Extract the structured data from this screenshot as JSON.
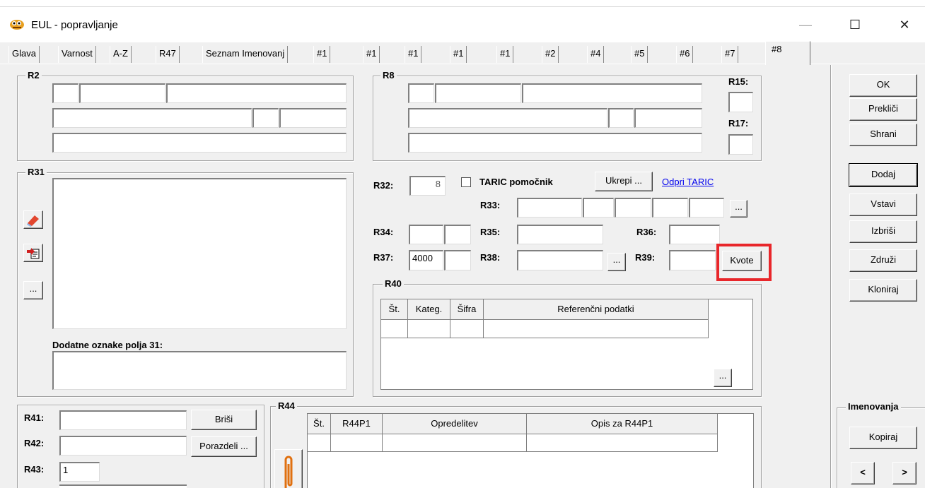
{
  "window": {
    "title": "EUL - popravljanje",
    "minimize_glyph": "—",
    "maximize_glyph": "☐",
    "close_glyph": "✕"
  },
  "tabs": [
    "Glava",
    "Varnost",
    "A-Z",
    "R47",
    "Seznam Imenovanj",
    "#1",
    "#1",
    "#1",
    "#1",
    "#1",
    "#2",
    "#4",
    "#5",
    "#6",
    "#7",
    "#8"
  ],
  "active_tab_index": 15,
  "groups": {
    "r2": "R2",
    "r8": "R8",
    "r31": "R31",
    "r40": "R40",
    "r44": "R44",
    "imenovanja": "Imenovanja"
  },
  "labels": {
    "r15": "R15:",
    "r17": "R17:",
    "r32": "R32:",
    "r33": "R33:",
    "r34": "R34:",
    "r35": "R35:",
    "r36": "R36:",
    "r37": "R37:",
    "r38": "R38:",
    "r39": "R39:",
    "r41": "R41:",
    "r42": "R42:",
    "r43": "R43:",
    "dodatne": "Dodatne oznake polja 31:",
    "taric_helper": "TARIC pomočnik"
  },
  "values": {
    "r32": "8",
    "r37": "4000",
    "r43": "1"
  },
  "buttons": {
    "ok": "OK",
    "preklici": "Prekliči",
    "shrani": "Shrani",
    "dodaj": "Dodaj",
    "vstavi": "Vstavi",
    "izbrisi": "Izbriši",
    "zdruzi": "Združi",
    "kloniraj": "Kloniraj",
    "kopiraj": "Kopiraj",
    "prev": "<",
    "next": ">",
    "ukrepi": "Ukrepi ...",
    "odpri_taric": "Odpri TARIC",
    "kvote": "Kvote",
    "brisi": "Briši",
    "porazdeli": "Porazdeli ...",
    "ellipsis": "..."
  },
  "r40_table": {
    "columns": [
      "Št.",
      "Kateg.",
      "Šifra",
      "Referenčni podatki"
    ]
  },
  "r44_table": {
    "columns": [
      "Št.",
      "R44P1",
      "Opredelitev",
      "Opis za R44P1"
    ]
  },
  "colors": {
    "highlight": "#e8262a",
    "link": "#0000ee"
  },
  "icons": [
    "app-icon",
    "eraser-icon",
    "paste-document-icon",
    "paperclip-icon"
  ]
}
